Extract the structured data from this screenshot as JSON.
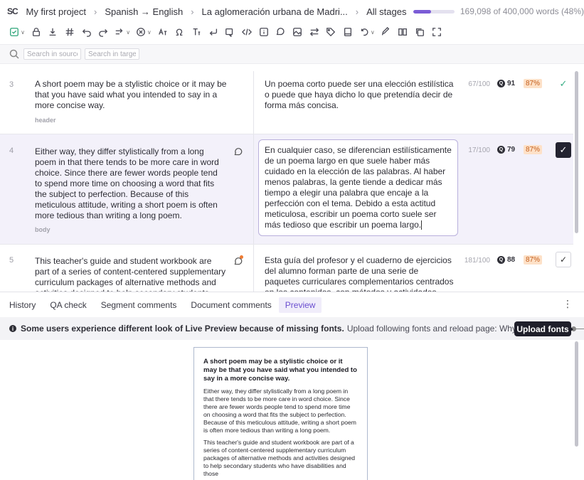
{
  "breadcrumb": {
    "logo": "SC",
    "project": "My first project",
    "language_pair": "Spanish → English",
    "document": "La aglomeración urbana de Madri...",
    "stage": "All stages",
    "progress": 0.423,
    "words": "169,098 of 400,000 words (48%)"
  },
  "toolbar": {
    "icons": [
      "confirm-icon",
      "lock-icon",
      "download-icon",
      "hash-icon",
      "undo-icon",
      "redo-icon",
      "propagate-icon",
      "clear-icon",
      "case-icon",
      "omega-icon",
      "text-format-icon",
      "enter-icon",
      "copy-source-icon",
      "code-icon",
      "info-box-icon",
      "comment-icon",
      "image-icon",
      "swap-icon",
      "tag-icon",
      "book-icon",
      "history-icon",
      "brush-icon",
      "book-open-icon",
      "copy-icon",
      "expand-icon"
    ]
  },
  "search": {
    "source_placeholder": "Search in source",
    "target_placeholder": "Search in target"
  },
  "segments": [
    {
      "number": "3",
      "source": "A short poem may be a stylistic choice or it may be that you have said what you intended to say in a more concise way.",
      "tag": "header",
      "target": "Un poema corto puede ser una elección estilística o puede que haya dicho lo que pretendía decir de forma más concisa.",
      "chars": "67/100",
      "qa": "91",
      "match": "87%"
    },
    {
      "number": "4",
      "source": "Either way, they differ stylistically from a long poem in that there tends to be more care in word choice. Since there are fewer words people tend to spend more time on choosing a word that fits the subject to perfection. Because of this meticulous attitude, writing a short poem is often more tedious than writing a long poem.",
      "tag": "body",
      "target": "En cualquier caso, se diferencian estilísticamente de un poema largo en que suele haber más cuidado en la elección de las palabras. Al haber menos palabras, la gente tiende a dedicar más tiempo a elegir una palabra que encaje a la perfección con el tema. Debido a esta actitud meticulosa, escribir un poema corto suele ser más tedioso que escribir un poema largo.",
      "chars": "17/100",
      "qa": "79",
      "match": "87%"
    },
    {
      "number": "5",
      "source": "This teacher's guide and student workbook are part of a series of content-centered supplementary curriculum packages of alternative methods and activities designed to help secondary students",
      "tag": "",
      "target": "Esta guía del profesor y el cuaderno de ejercicios del alumno forman parte de una serie de paquetes curriculares complementarios centrados en los contenidos, con métodos y actividades alternativos",
      "chars": "181/100",
      "qa": "88",
      "match": "87%"
    }
  ],
  "tabs": [
    "History",
    "QA check",
    "Segment comments",
    "Document comments",
    "Preview"
  ],
  "active_tab": "Preview",
  "notice": {
    "bold": "Some users experience different look of Live Preview because of missing fonts.",
    "rest": "Upload following fonts and reload page: Whyat",
    "button": "Upload fonts"
  },
  "preview": {
    "heading": "A short poem may be a stylistic choice or it may be that you have said what you intended to say in a more concise way.",
    "paragraphs": [
      "Either way, they differ stylistically from a long poem in that there tends to be more care in word choice. Since there are fewer words people tend to spend more time on choosing a word that fits the subject to perfection. Because of this meticulous attitude, writing a short poem is often more tedious than writing a long poem.",
      "This teacher's guide and student workbook are part of a series of content-centered supplementary curriculum packages of alternative methods and activities designed to help secondary students who have disabilities and those"
    ]
  }
}
